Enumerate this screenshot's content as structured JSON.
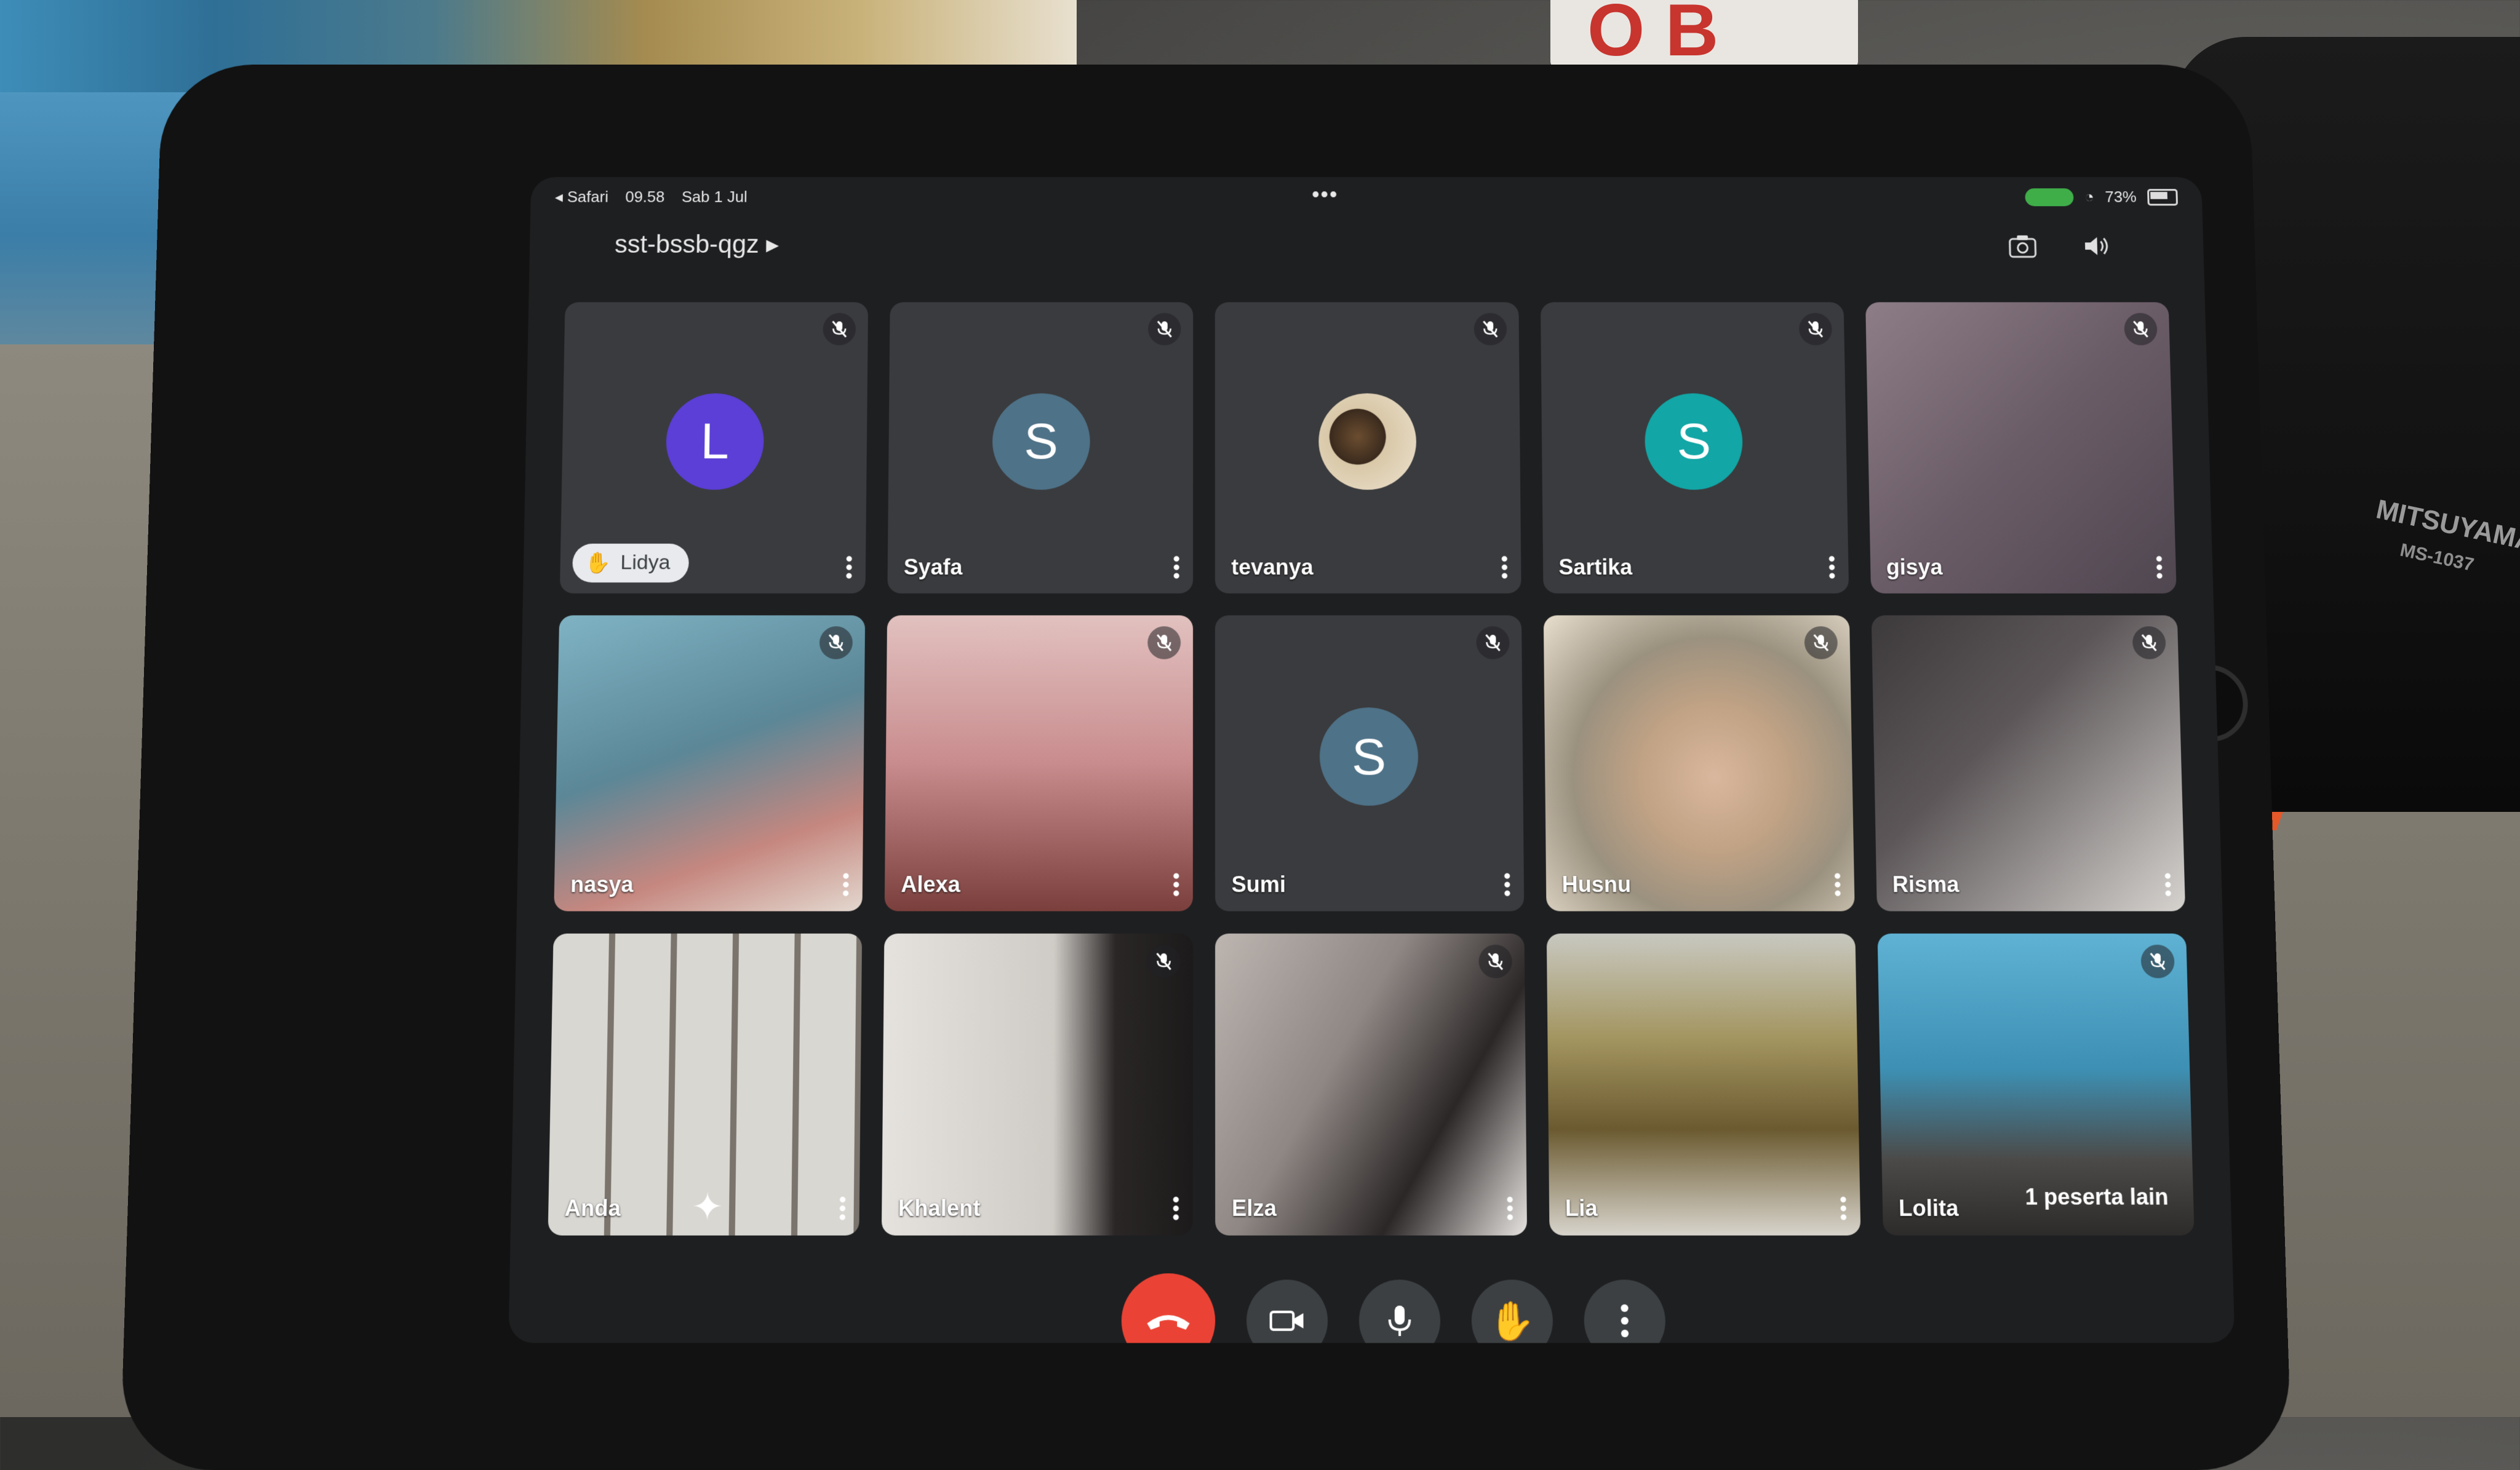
{
  "status_bar": {
    "back_app": "Safari",
    "time": "09.58",
    "date": "Sab 1 Jul",
    "battery": "73%"
  },
  "meeting": {
    "code": "sst-bssb-qgz"
  },
  "tiles": [
    {
      "name": "Lidya",
      "type": "avatar",
      "initial": "L",
      "color": "#5b3fd6",
      "hand_raised": true,
      "muted": true
    },
    {
      "name": "Syafa",
      "type": "avatar",
      "initial": "S",
      "color": "#4e7288",
      "muted": true
    },
    {
      "name": "tevanya",
      "type": "photo-avatar",
      "initial": "",
      "color": "#d8c9a6",
      "muted": true
    },
    {
      "name": "Sartika",
      "type": "avatar",
      "initial": "S",
      "color": "#12a6a6",
      "muted": true
    },
    {
      "name": "gisya",
      "type": "video",
      "color": "#7a6a77",
      "muted": true
    },
    {
      "name": "nasya",
      "type": "video",
      "color": "#5f8fa0",
      "muted": true
    },
    {
      "name": "Alexa",
      "type": "video",
      "color": "#b88788",
      "muted": true
    },
    {
      "name": "Sumi",
      "type": "avatar",
      "initial": "S",
      "color": "#4e7288",
      "muted": true
    },
    {
      "name": "Husnu",
      "type": "video",
      "color": "#bba98d",
      "muted": true
    },
    {
      "name": "Risma",
      "type": "video",
      "color": "#6f6a6c",
      "muted": true
    },
    {
      "name": "Anda",
      "type": "video",
      "color": "#9a9a9a",
      "muted": false,
      "self": true
    },
    {
      "name": "Khalent",
      "type": "video",
      "color": "#c9c4bf",
      "muted": true
    },
    {
      "name": "Elza",
      "type": "video",
      "color": "#8a8685",
      "muted": true
    },
    {
      "name": "Lia",
      "type": "video",
      "color": "#8a7c53",
      "muted": false
    },
    {
      "name": "Lolita",
      "type": "video",
      "color": "#4b98b6",
      "muted": true,
      "extra": "1 peserta lain"
    }
  ],
  "controls": {
    "end_call": "end-call-icon",
    "camera": "video-camera-icon",
    "mic": "microphone-icon",
    "raise_hand": "raise-hand-icon",
    "more": "more-options-icon"
  },
  "scene": {
    "lamp_brand": "MITSUYAMA",
    "lamp_model": "MS-1037",
    "paper_letters": "O B"
  }
}
